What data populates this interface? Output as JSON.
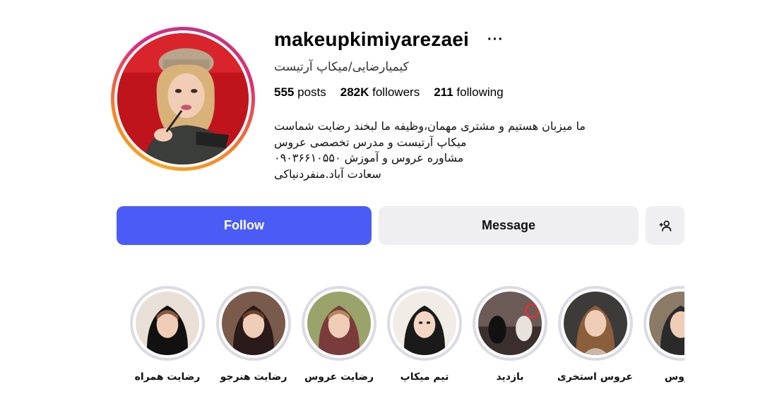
{
  "profile": {
    "username": "makeupkimiyarezaei",
    "more_label": "···",
    "full_name": "کیمیارضایی/میکاپ آرتیست",
    "stats": {
      "posts_count": "555",
      "posts_label": "posts",
      "followers_count": "282K",
      "followers_label": "followers",
      "following_count": "211",
      "following_label": "following"
    },
    "bio": [
      "ما میزبان هستیم و مشتری مهمان،وظیفه ما لبخند رضایت شماست",
      "میکاپ آرتیست و مدرس تخصصی عروس",
      "مشاوره عروس و آموزش ۰۹۰۳۶۶۱۰۵۵۰",
      "سعادت آباد.منفردنیاکی"
    ]
  },
  "actions": {
    "follow_label": "Follow",
    "message_label": "Message",
    "add_icon": "+👤"
  },
  "highlights": [
    {
      "label": "رضایت همراه",
      "scarf": "#111111",
      "bg": "#e9dfd6"
    },
    {
      "label": "رضایت هنرجو",
      "scarf": "#2a1a1a",
      "bg": "#7a5a4a"
    },
    {
      "label": "رضایت عروس",
      "scarf": "#7a3b3b",
      "bg": "#9aa46a"
    },
    {
      "label": "تیم میکاپ",
      "scarf": "#1a1a1a",
      "bg": "#f2ece6"
    },
    {
      "label": "بازدید",
      "scarf": "#333333",
      "bg": "#6b5a55"
    },
    {
      "label": "عروس استخری",
      "scarf": "#c9b8a8",
      "bg": "#3d3a3a"
    },
    {
      "label": "عروس",
      "scarf": "#2a2a2a",
      "bg": "#8a7a66"
    }
  ],
  "colors": {
    "follow_bg": "#4b5cf6",
    "secondary_bg": "#efeff2",
    "highlight_ring": "#dbdbe3"
  }
}
